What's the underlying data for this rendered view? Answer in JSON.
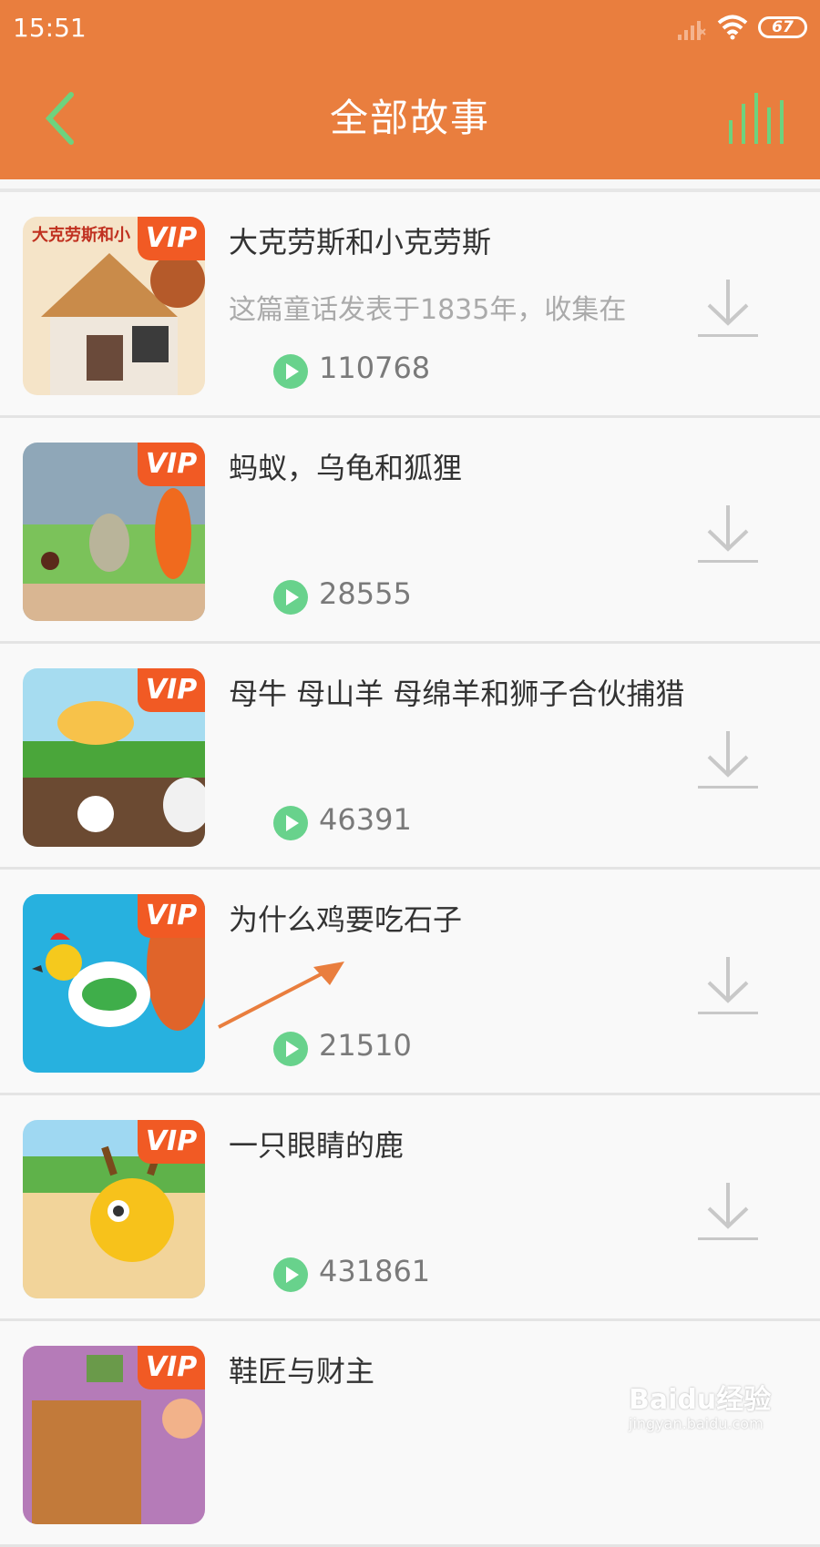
{
  "status_bar": {
    "time": "15:51",
    "battery": "67"
  },
  "header": {
    "title": "全部故事",
    "back_icon": "chevron-left-icon",
    "player_icon": "audio-bars-icon",
    "accent": "#e97e3e"
  },
  "stories": [
    {
      "title": "大克劳斯和小克劳斯",
      "desc": "这篇童话发表于1835年，收集在",
      "plays": "110768",
      "badge": "VIP",
      "thumb_text": "大克劳斯和小"
    },
    {
      "title": "蚂蚁，乌龟和狐狸",
      "desc": "",
      "plays": "28555",
      "badge": "VIP"
    },
    {
      "title": "母牛 母山羊 母绵羊和狮子合伙捕猎",
      "desc": "",
      "plays": "46391",
      "badge": "VIP"
    },
    {
      "title": "为什么鸡要吃石子",
      "desc": "",
      "plays": "21510",
      "badge": "VIP"
    },
    {
      "title": "一只眼睛的鹿",
      "desc": "",
      "plays": "431861",
      "badge": "VIP"
    },
    {
      "title": "鞋匠与财主",
      "desc": "",
      "plays": "",
      "badge": "VIP"
    }
  ],
  "watermark": {
    "brand": "Baidu经验",
    "url": "jingyan.baidu.com"
  }
}
